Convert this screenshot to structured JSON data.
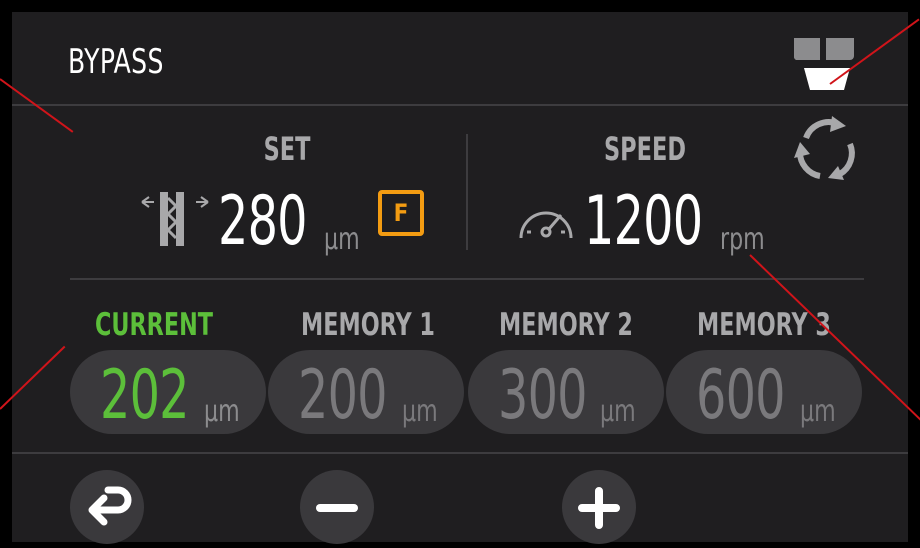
{
  "header": {
    "title": "BYPASS"
  },
  "set": {
    "label": "SET",
    "value": "280",
    "unit": "μm",
    "badge": "F"
  },
  "speed": {
    "label": "SPEED",
    "value": "1200",
    "unit": "rpm"
  },
  "memories": [
    {
      "label": "CURRENT",
      "value": "202",
      "unit": "μm",
      "active": true
    },
    {
      "label": "MEMORY 1",
      "value": "200",
      "unit": "μm",
      "active": false
    },
    {
      "label": "MEMORY 2",
      "value": "300",
      "unit": "μm",
      "active": false
    },
    {
      "label": "MEMORY 3",
      "value": "600",
      "unit": "μm",
      "active": false
    }
  ],
  "colors": {
    "accent_green": "#5cbf3a",
    "badge_orange": "#f39c12",
    "callout_red": "#d0141a"
  }
}
